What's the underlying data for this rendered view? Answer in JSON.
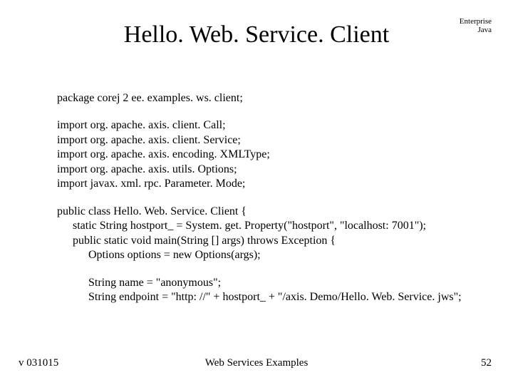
{
  "corner": {
    "line1": "Enterprise",
    "line2": "Java"
  },
  "title": "Hello. Web. Service. Client",
  "code": {
    "package": "package corej 2 ee. examples. ws. client;",
    "imports": "import org. apache. axis. client. Call;\nimport org. apache. axis. client. Service;\nimport org. apache. axis. encoding. XMLType;\nimport org. apache. axis. utils. Options;\nimport javax. xml. rpc. Parameter. Mode;",
    "class_decl": "public class Hello. Web. Service. Client {",
    "hostport": "static String hostport_ = System. get. Property(\"hostport\", \"localhost: 7001\");",
    "main_sig": "public static void main(String [] args) throws Exception {",
    "options": "Options options = new Options(args);",
    "name_line": "String name = \"anonymous\";",
    "endpoint_line": "String endpoint = \"http: //\" + hostport_  + \"/axis. Demo/Hello. Web. Service. jws\";"
  },
  "footer": {
    "left": "v 031015",
    "center": "Web Services Examples",
    "right": "52"
  }
}
